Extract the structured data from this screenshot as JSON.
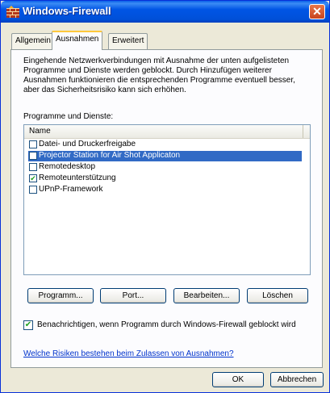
{
  "window": {
    "title": "Windows-Firewall",
    "close_label": "✕",
    "accent": "#0055e5"
  },
  "tabs": [
    {
      "label": "Allgemein",
      "active": false
    },
    {
      "label": "Ausnahmen",
      "active": true
    },
    {
      "label": "Erweitert",
      "active": false
    }
  ],
  "description": "Eingehende Netzwerkverbindungen mit Ausnahme der unten aufgelisteten Programme und Dienste werden geblockt. Durch Hinzufügen weiterer Ausnahmen funktionieren die entsprechenden Programme eventuell besser, aber das Sicherheitsrisiko kann sich erhöhen.",
  "programs": {
    "label": "Programme und Dienste:",
    "column_header": "Name",
    "items": [
      {
        "label": "Datei- und Druckerfreigabe",
        "checked": false,
        "selected": false
      },
      {
        "label": "Projector Station for Air Shot Applicaton",
        "checked": false,
        "selected": true
      },
      {
        "label": "Remotedesktop",
        "checked": false,
        "selected": false
      },
      {
        "label": "Remoteunterstützung",
        "checked": true,
        "selected": false
      },
      {
        "label": "UPnP-Framework",
        "checked": false,
        "selected": false
      }
    ]
  },
  "buttons": {
    "program": "Programm...",
    "port": "Port...",
    "edit": "Bearbeiten...",
    "delete": "Löschen",
    "ok": "OK",
    "cancel": "Abbrechen"
  },
  "notify": {
    "label": "Benachrichtigen, wenn Programm durch Windows-Firewall geblockt wird",
    "checked": true
  },
  "risk_link": "Welche Risiken bestehen beim Zulassen von Ausnahmen?"
}
